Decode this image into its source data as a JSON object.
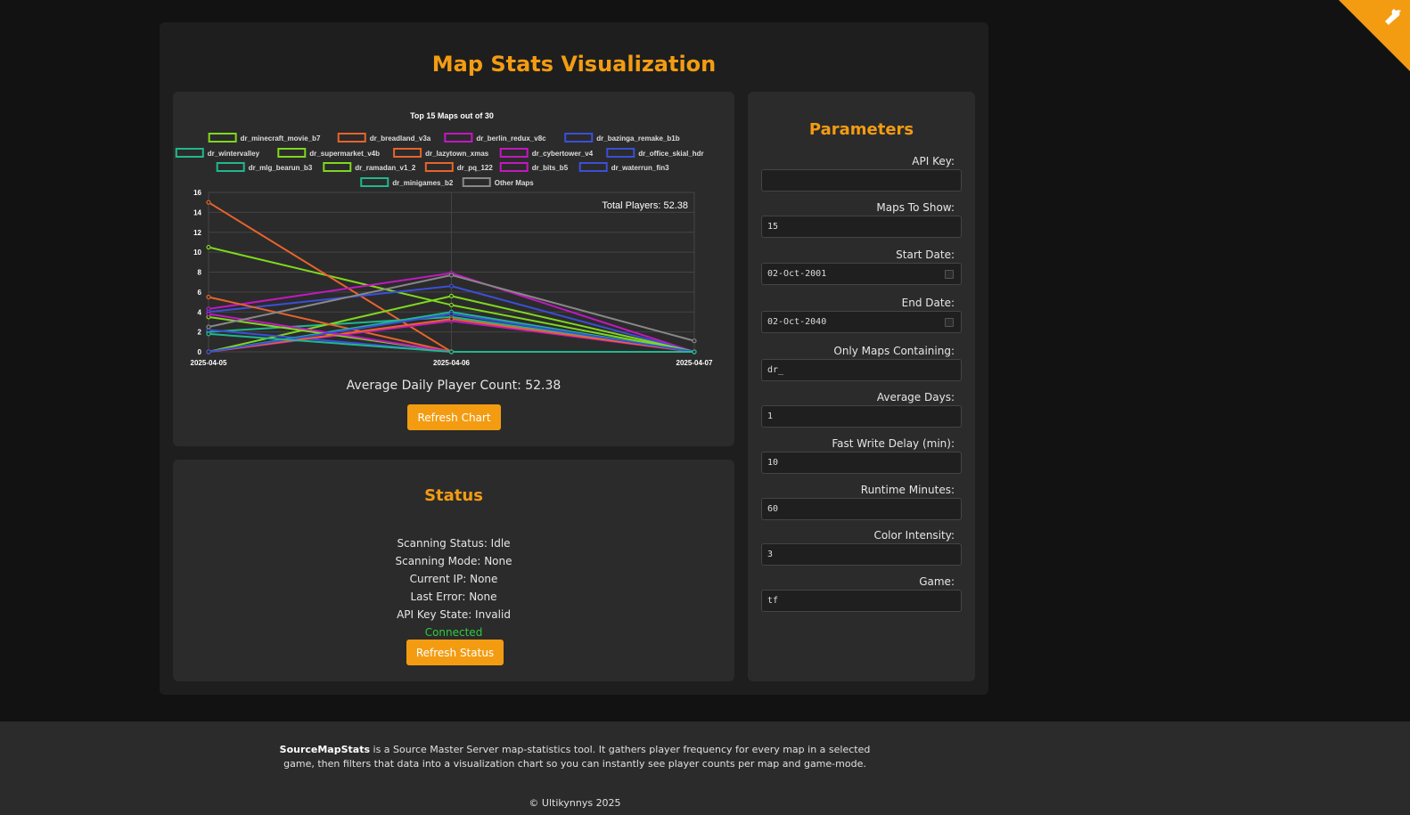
{
  "page": {
    "title": "Map Stats Visualization"
  },
  "chart_data": {
    "type": "line",
    "title": "Top 15 Maps out of 30",
    "annotation": "Total Players: 52.38",
    "x": [
      "2025-04-05",
      "2025-04-06",
      "2025-04-07"
    ],
    "ylim": [
      0,
      16
    ],
    "yticks": [
      0,
      2,
      4,
      6,
      8,
      10,
      12,
      14,
      16
    ],
    "grid": true,
    "legend_position": "top",
    "series": [
      {
        "name": "dr_minecraft_movie_b7",
        "color": "#7fd81e",
        "values": [
          10.5,
          4.7,
          0
        ]
      },
      {
        "name": "dr_breadland_v3a",
        "color": "#e8632a",
        "values": [
          15,
          0,
          0
        ]
      },
      {
        "name": "dr_berlin_redux_v8c",
        "color": "#c218c2",
        "values": [
          4.3,
          7.9,
          0
        ]
      },
      {
        "name": "dr_bazinga_remake_b1b",
        "color": "#3b4fd8",
        "values": [
          4,
          6.6,
          0
        ]
      },
      {
        "name": "dr_wintervalley",
        "color": "#1fb88f",
        "values": [
          2,
          3.5,
          0
        ]
      },
      {
        "name": "dr_supermarket_v4b",
        "color": "#7fd81e",
        "values": [
          0,
          5.6,
          0
        ]
      },
      {
        "name": "dr_lazytown_xmas",
        "color": "#e8632a",
        "values": [
          5.5,
          0,
          0
        ]
      },
      {
        "name": "dr_cybertower_v4",
        "color": "#c218c2",
        "values": [
          0,
          3.1,
          0
        ]
      },
      {
        "name": "dr_office_skial_hdr",
        "color": "#3b4fd8",
        "values": [
          2.2,
          0,
          0
        ]
      },
      {
        "name": "dr_mlg_bearun_b3",
        "color": "#1fb88f",
        "values": [
          0,
          4,
          0
        ]
      },
      {
        "name": "dr_ramadan_v1_2",
        "color": "#7fd81e",
        "values": [
          3.5,
          0,
          0
        ]
      },
      {
        "name": "dr_pq_122",
        "color": "#e8632a",
        "values": [
          0,
          3.3,
          0
        ]
      },
      {
        "name": "dr_bits_b5",
        "color": "#c218c2",
        "values": [
          3.8,
          0,
          0
        ]
      },
      {
        "name": "dr_waterrun_fin3",
        "color": "#3b4fd8",
        "values": [
          0,
          3.8,
          0
        ]
      },
      {
        "name": "dr_minigames_b2",
        "color": "#1fb88f",
        "values": [
          1.8,
          0,
          0
        ]
      },
      {
        "name": "Other Maps",
        "color": "#888888",
        "values": [
          2.5,
          7.7,
          1.1
        ]
      }
    ]
  },
  "chart": {
    "average_text": "Average Daily Player Count: 52.38",
    "refresh_label": "Refresh Chart"
  },
  "status": {
    "title": "Status",
    "lines": [
      "Scanning Status: Idle",
      "Scanning Mode: None",
      "Current IP: None",
      "Last Error: None",
      "API Key State: Invalid"
    ],
    "connection": "Connected",
    "connection_color": "#2ecc40",
    "refresh_label": "Refresh Status"
  },
  "params": {
    "title": "Parameters",
    "fields": [
      {
        "label": "API Key:",
        "value": ""
      },
      {
        "label": "Maps To Show:",
        "value": "15"
      },
      {
        "label": "Start Date:",
        "value": "02-Oct-2001"
      },
      {
        "label": "End Date:",
        "value": "02-Oct-2040"
      },
      {
        "label": "Only Maps Containing:",
        "value": "dr_"
      },
      {
        "label": "Average Days:",
        "value": "1"
      },
      {
        "label": "Fast Write Delay (min):",
        "value": "10"
      },
      {
        "label": "Runtime Minutes:",
        "value": "60"
      },
      {
        "label": "Color Intensity:",
        "value": "3"
      },
      {
        "label": "Game:",
        "value": "tf"
      }
    ]
  },
  "footer": {
    "brand": "SourceMapStats",
    "description": " is a Source Master Server map-statistics tool. It gathers player frequency for every map in a selected game, then filters that data into a visualization chart so you can instantly see player counts per map and game-mode.",
    "copyright": "© Ultikynnys 2025"
  },
  "theme": {
    "accent": "#f39c12",
    "background": "#121212",
    "panel": "#2b2b2b"
  }
}
